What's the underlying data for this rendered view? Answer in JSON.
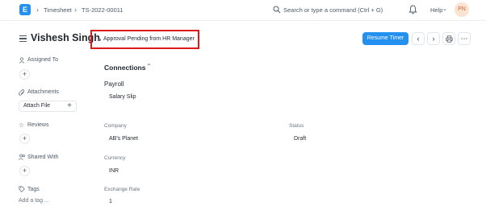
{
  "navbar": {
    "logo_letter": "E",
    "breadcrumbs": [
      "Timesheet",
      "TS-2022-00011"
    ],
    "search_placeholder": "Search or type a command (Ctrl + G)",
    "help_label": "Help",
    "avatar_initials": "PN"
  },
  "header": {
    "title": "Vishesh Singh",
    "status": "Approval Pending from HR Manager",
    "primary_button": "Resume Timer"
  },
  "sidebar": {
    "assigned_to": "Assigned To",
    "attachments": "Attachments",
    "attach_file": "Attach File",
    "reviews": "Reviews",
    "shared_with": "Shared With",
    "tags": "Tags",
    "add_tag": "Add a tag ..."
  },
  "main": {
    "section_title": "Connections",
    "group_title": "Payroll",
    "link": "Salary Slip",
    "fields": {
      "company_label": "Company",
      "company_value": "AB's Planet",
      "status_label": "Status",
      "status_value": "Draft",
      "currency_label": "Currency",
      "currency_value": "INR",
      "exchange_rate_label": "Exchange Rate",
      "exchange_rate_value": "1"
    }
  },
  "colors": {
    "primary": "#2490ef",
    "highlight_border": "#e01919"
  }
}
